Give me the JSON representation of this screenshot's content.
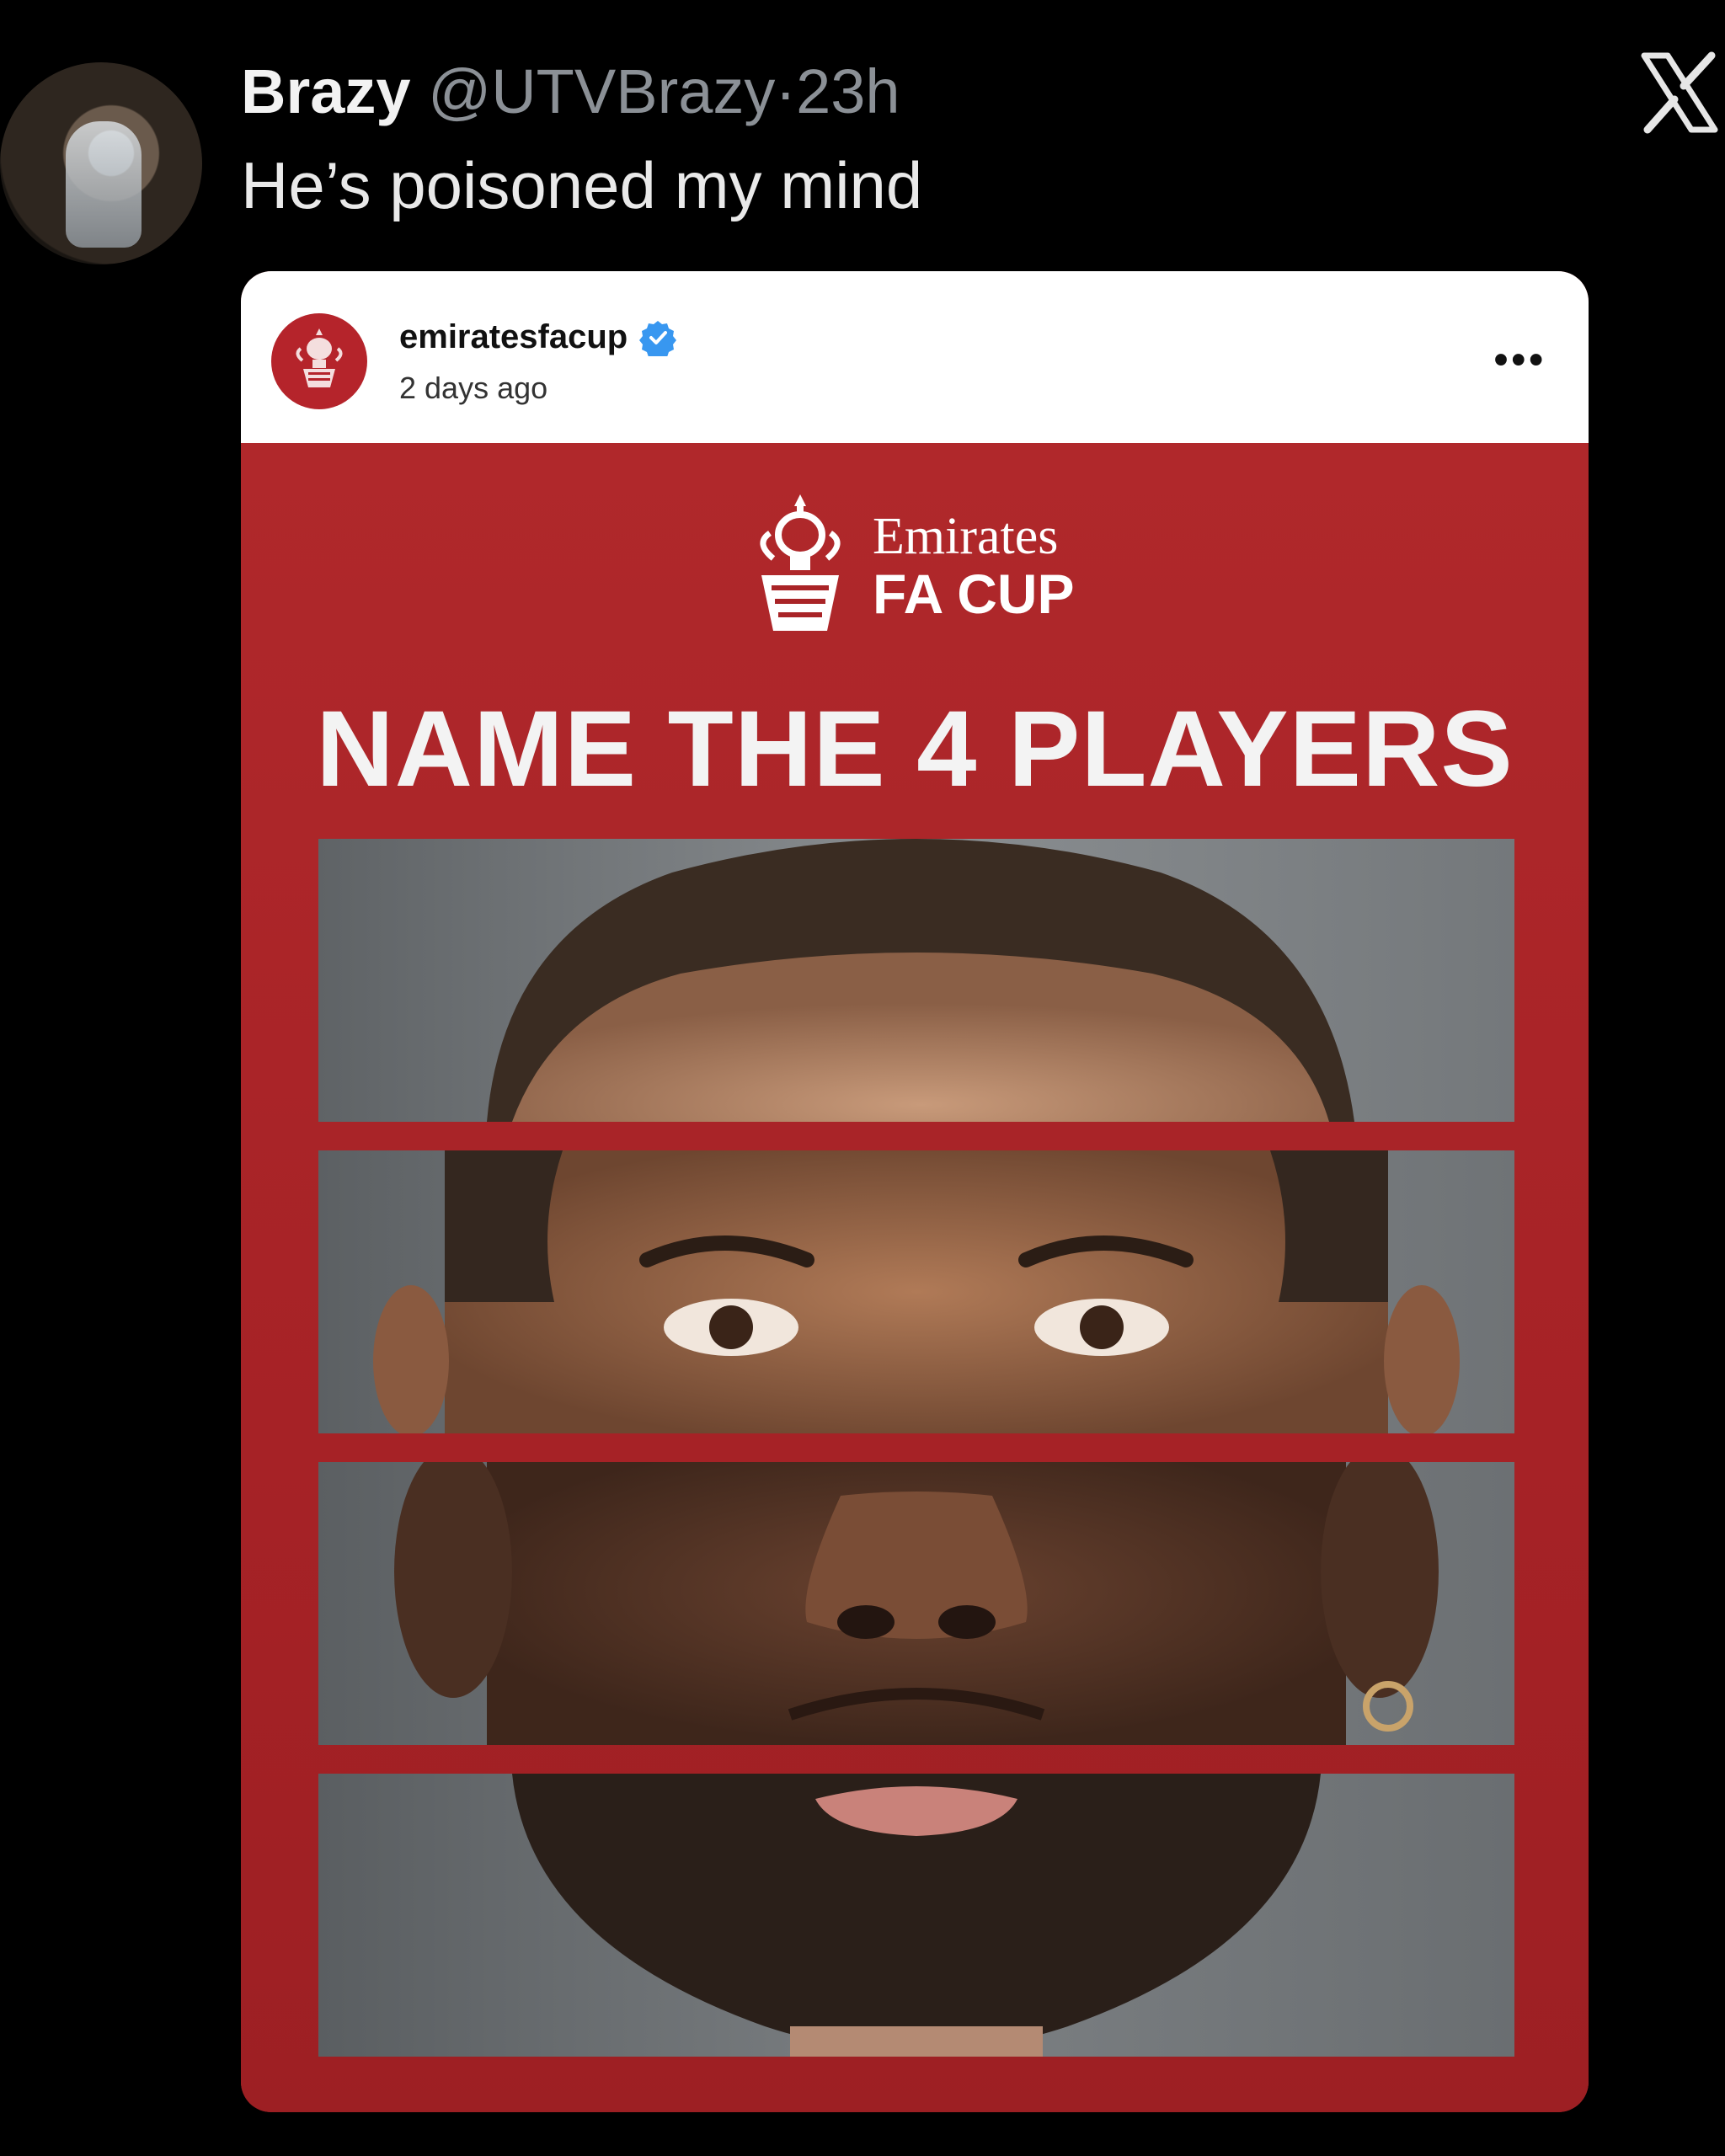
{
  "tweet": {
    "display_name": "Brazy",
    "handle": "@UTVBrazy",
    "separator": "·",
    "time": "23h",
    "text": "He’s poisoned my mind"
  },
  "post": {
    "username": "emiratesfacup",
    "time": "2 days ago",
    "image": {
      "brand_line1": "Emirates",
      "brand_line2": "FA CUP",
      "headline": "NAME THE 4 PLAYERS"
    }
  },
  "colors": {
    "background": "#000000",
    "card_red": "#a92427",
    "verified_blue": "#3897f0"
  }
}
